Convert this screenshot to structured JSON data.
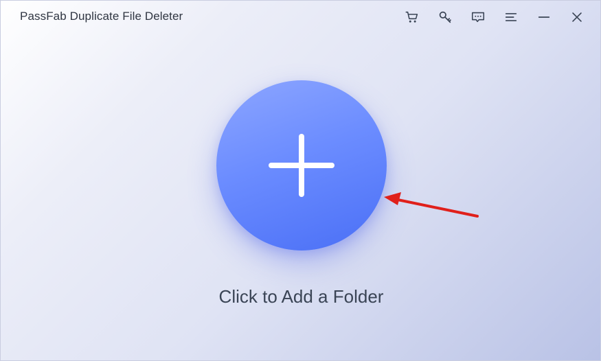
{
  "app": {
    "title": "PassFab Duplicate File Deleter"
  },
  "titlebar": {
    "icons": [
      {
        "name": "cart-icon"
      },
      {
        "name": "key-icon"
      },
      {
        "name": "feedback-icon"
      },
      {
        "name": "menu-icon"
      },
      {
        "name": "minimize-icon"
      },
      {
        "name": "close-icon"
      }
    ]
  },
  "main": {
    "add_folder_label": "Click to Add a Folder"
  },
  "colors": {
    "accent": "#5b7cfa",
    "annotation_arrow": "#e0201b",
    "text": "#3a4455"
  }
}
